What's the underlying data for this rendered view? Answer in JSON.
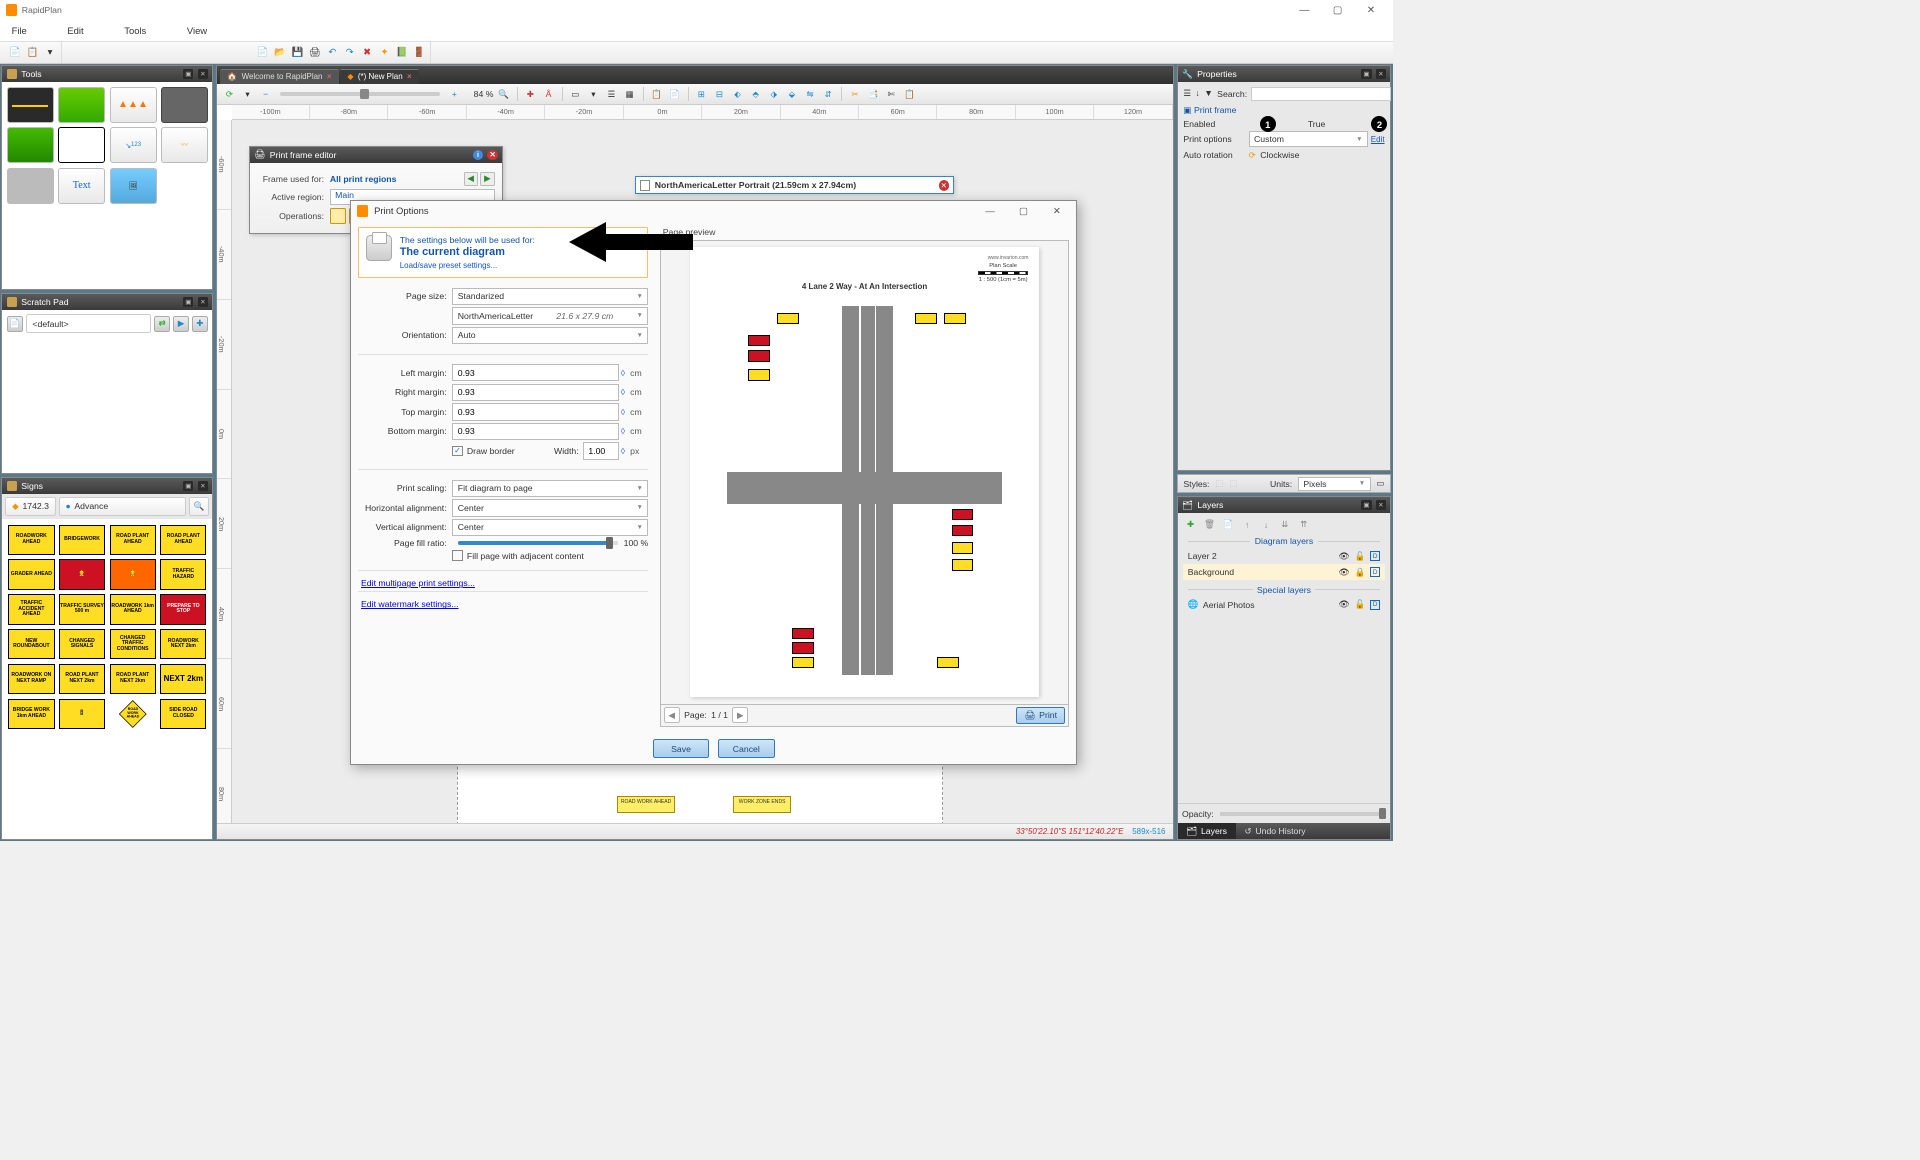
{
  "app": {
    "title": "RapidPlan"
  },
  "window_controls": {
    "min": "—",
    "max": "▢",
    "close": "✕"
  },
  "menubar": {
    "items": [
      "File",
      "Edit",
      "Tools",
      "View"
    ]
  },
  "panels": {
    "tools": {
      "title": "Tools"
    },
    "scratch": {
      "title": "Scratch Pad",
      "default_label": "<default>"
    },
    "signs": {
      "title": "Signs",
      "code": "1742.3",
      "group": "Advance",
      "items": [
        "ROADWORK AHEAD",
        "BRIDGEWORK",
        "ROAD PLANT AHEAD",
        "ROAD PLANT AHEAD",
        "GRADER AHEAD",
        "worker",
        "worker",
        "TRAFFIC HAZARD",
        "TRAFFIC ACCIDENT AHEAD",
        "TRAFFIC SURVEY 500 m",
        "ROADWORK 1km AHEAD",
        "PREPARE TO STOP",
        "NEW ROUNDABOUT",
        "CHANGED SIGNALS",
        "CHANGED TRAFFIC CONDITIONS",
        "ROADWORK NEXT 2km",
        "ROADWORK ON NEXT RAMP",
        "ROAD PLANT NEXT 2km",
        "ROAD PLANT NEXT 2km",
        "NEXT 2km",
        "BRIDGE WORK 1km AHEAD",
        "signal",
        "ROAD WORK AHEAD",
        "SIDE ROAD CLOSED"
      ]
    }
  },
  "doc_tabs": {
    "welcome": "Welcome to RapidPlan",
    "new_plan": "(*) New Plan"
  },
  "canvas_toolbar": {
    "zoom_pct": "84 %"
  },
  "ruler_h": [
    "-100m",
    "-80m",
    "-60m",
    "-40m",
    "-20m",
    "0m",
    "20m",
    "40m",
    "60m",
    "80m",
    "100m",
    "120m"
  ],
  "ruler_v": [
    "-60m",
    "-40m",
    "-20m",
    "0m",
    "20m",
    "40m",
    "60m",
    "80m"
  ],
  "status": {
    "coords": "33°50'22.10\"S 151°12'40.22\"E",
    "res": "589x-516"
  },
  "canvas_labels": {
    "strip1": "ROAD WORK AHEAD",
    "strip2": "WORK ZONE ENDS"
  },
  "pfe": {
    "title": "Print frame editor",
    "frame_used_label": "Frame used for:",
    "frame_used_value": "All print regions",
    "active_region_label": "Active region:",
    "active_region_value": "Main",
    "operations_label": "Operations:"
  },
  "portrait_popup": {
    "title": "NorthAmericaLetter Portrait (21.59cm x 27.94cm)"
  },
  "print_options": {
    "title": "Print Options",
    "header_line1": "The settings below will be used for:",
    "header_line2": "The current diagram",
    "header_link": "Load/save preset settings...",
    "page_size_label": "Page size:",
    "page_size_value": "Standarized",
    "paper_name": "NorthAmericaLetter",
    "paper_dims": "21.6 x 27.9 cm",
    "orientation_label": "Orientation:",
    "orientation_value": "Auto",
    "margins": {
      "left_label": "Left margin:",
      "left": "0.93",
      "right_label": "Right margin:",
      "right": "0.93",
      "top_label": "Top margin:",
      "top": "0.93",
      "bottom_label": "Bottom margin:",
      "bottom": "0.93",
      "unit": "cm"
    },
    "draw_border_label": "Draw border",
    "border_width_label": "Width:",
    "border_width": "1.00",
    "border_unit": "px",
    "print_scaling_label": "Print scaling:",
    "print_scaling_value": "Fit diagram to page",
    "h_align_label": "Horizontal alignment:",
    "h_align_value": "Center",
    "v_align_label": "Vertical alignment:",
    "v_align_value": "Center",
    "page_fill_label": "Page fill ratio:",
    "page_fill_value": "100 %",
    "fill_adjacent_label": "Fill page with adjacent content",
    "link_multipage": "Edit multipage print settings...",
    "link_watermark": "Edit watermark settings...",
    "preview_label": "Page preview",
    "preview_title": "4 Lane 2 Way - At An Intersection",
    "preview_url": "www.invarion.com",
    "preview_scale_top": "Plan Scale",
    "preview_scale_ratio": "1 : 500 (1cm = 5m)",
    "page_nav_label": "Page:",
    "page_nav_value": "1 / 1",
    "print_btn": "Print",
    "save_btn": "Save",
    "cancel_btn": "Cancel"
  },
  "properties": {
    "title": "Properties",
    "search_label": "Search:",
    "section": "Print frame",
    "enabled_label": "Enabled",
    "enabled_value": "True",
    "print_options_label": "Print options",
    "print_options_value": "Custom",
    "edit_link": "Edit",
    "auto_rotation_label": "Auto rotation",
    "auto_rotation_value": "Clockwise",
    "badge1": "1",
    "badge2": "2"
  },
  "style_bar": {
    "styles_label": "Styles:",
    "units_label": "Units:",
    "units_value": "Pixels"
  },
  "layers": {
    "title": "Layers",
    "diagram_sec": "Diagram layers",
    "special_sec": "Special layers",
    "layer2": "Layer 2",
    "background": "Background",
    "aerial": "Aerial Photos",
    "opacity_label": "Opacity:",
    "tabs": {
      "layers": "Layers",
      "undo": "Undo History"
    }
  }
}
